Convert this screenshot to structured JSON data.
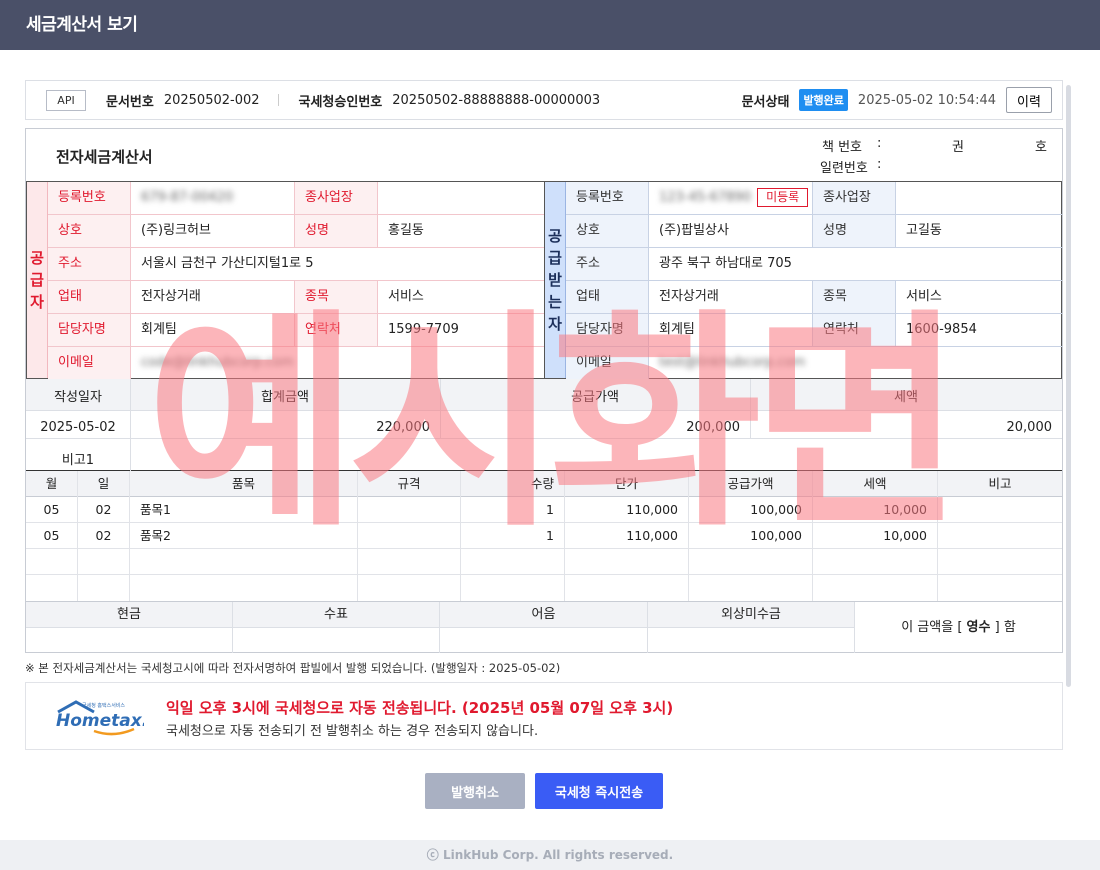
{
  "window": {
    "title": "세금계산서 보기"
  },
  "info_bar": {
    "api_badge": "API",
    "doc_no_label": "문서번호",
    "doc_no": "20250502-002",
    "nts_label": "국세청승인번호",
    "nts_no": "20250502-88888888-00000003",
    "status_label": "문서상태",
    "status": "발행완료",
    "datetime": "2025-05-02 10:54:44",
    "history_button": "이력"
  },
  "invoice": {
    "title": "전자세금계산서",
    "book_no_label": "책 번호",
    "book_colon": ":",
    "book_kwon": "권",
    "book_ho": "호",
    "serial_label": "일련번호",
    "serial_colon": ":"
  },
  "supplier": {
    "side_label": [
      "공",
      "급",
      "자"
    ],
    "reg_no_label": "등록번호",
    "reg_no": "679-87-00420",
    "branch_label": "종사업장",
    "branch": "",
    "company_label": "상호",
    "company": "(주)링크허브",
    "ceo_label": "성명",
    "ceo": "홍길동",
    "address_label": "주소",
    "address": "서울시 금천구 가산디지털1로 5",
    "biz_type_label": "업태",
    "biz_type": "전자상거래",
    "biz_item_label": "종목",
    "biz_item": "서비스",
    "contact_label": "담당자명",
    "contact": "회계팀",
    "tel_label": "연락처",
    "tel": "1599-7709",
    "email_label": "이메일",
    "email": "code@linkhubcorp.com"
  },
  "buyer": {
    "side_label": [
      "공",
      "급",
      "받",
      "는",
      "자"
    ],
    "reg_no_label": "등록번호",
    "reg_no": "123-45-67890",
    "unregistered": "미등록",
    "branch_label": "종사업장",
    "branch": "",
    "company_label": "상호",
    "company": "(주)팝빌상사",
    "ceo_label": "성명",
    "ceo": "고길동",
    "address_label": "주소",
    "address": "광주 북구 하남대로 705",
    "biz_type_label": "업태",
    "biz_type": "전자상거래",
    "biz_item_label": "종목",
    "biz_item": "서비스",
    "contact_label": "담당자명",
    "contact": "회계팀",
    "tel_label": "연락처",
    "tel": "1600-9854",
    "email_label": "이메일",
    "email": "test@linkhubcorp.com"
  },
  "summary": {
    "write_date_label": "작성일자",
    "total_label": "합계금액",
    "supply_label": "공급가액",
    "tax_label": "세액",
    "write_date": "2025-05-02",
    "total": "220,000",
    "supply": "200,000",
    "tax": "20,000",
    "remark_label": "비고1"
  },
  "items": {
    "headers": [
      "월",
      "일",
      "품목",
      "규격",
      "수량",
      "단가",
      "공급가액",
      "세액",
      "비고"
    ],
    "rows": [
      {
        "month": "05",
        "day": "02",
        "name": "품목1",
        "spec": "",
        "qty": "1",
        "unit_price": "110,000",
        "supply": "100,000",
        "tax": "10,000",
        "remark": ""
      },
      {
        "month": "05",
        "day": "02",
        "name": "품목2",
        "spec": "",
        "qty": "1",
        "unit_price": "110,000",
        "supply": "100,000",
        "tax": "10,000",
        "remark": ""
      }
    ]
  },
  "payment": {
    "cash_label": "현금",
    "check_label": "수표",
    "note_label": "어음",
    "credit_label": "외상미수금",
    "receipt_prefix": "이 금액을 [",
    "receipt_type": "영수",
    "receipt_suffix": "] 함"
  },
  "notice": "※ 본 전자세금계산서는 국세청고시에 따라 전자서명하여 팝빌에서 발행 되었습니다. (발행일자 : 2025-05-02)",
  "hometax": {
    "logo_text": "Hometax.",
    "logo_small": "국세청 홈택스서비스",
    "headline": "익일 오후 3시에 국세청으로 자동 전송됩니다. (2025년 05월 07일 오후 3시)",
    "subtext": "국세청으로 자동 전송되기 전 발행취소 하는 경우 전송되지 않습니다."
  },
  "buttons": {
    "cancel": "발행취소",
    "send_now": "국세청 즉시전송"
  },
  "watermark": "예시화면",
  "footer": "ⓒ LinkHub Corp. All rights reserved.",
  "colors": {
    "titlebar": "#4a5068",
    "status_badge": "#1f8ef1",
    "supplier_accent": "#e0192e",
    "buyer_accent": "#cfe0fb",
    "send_button": "#3a5cf5",
    "cancel_button": "#a9b0c2"
  }
}
